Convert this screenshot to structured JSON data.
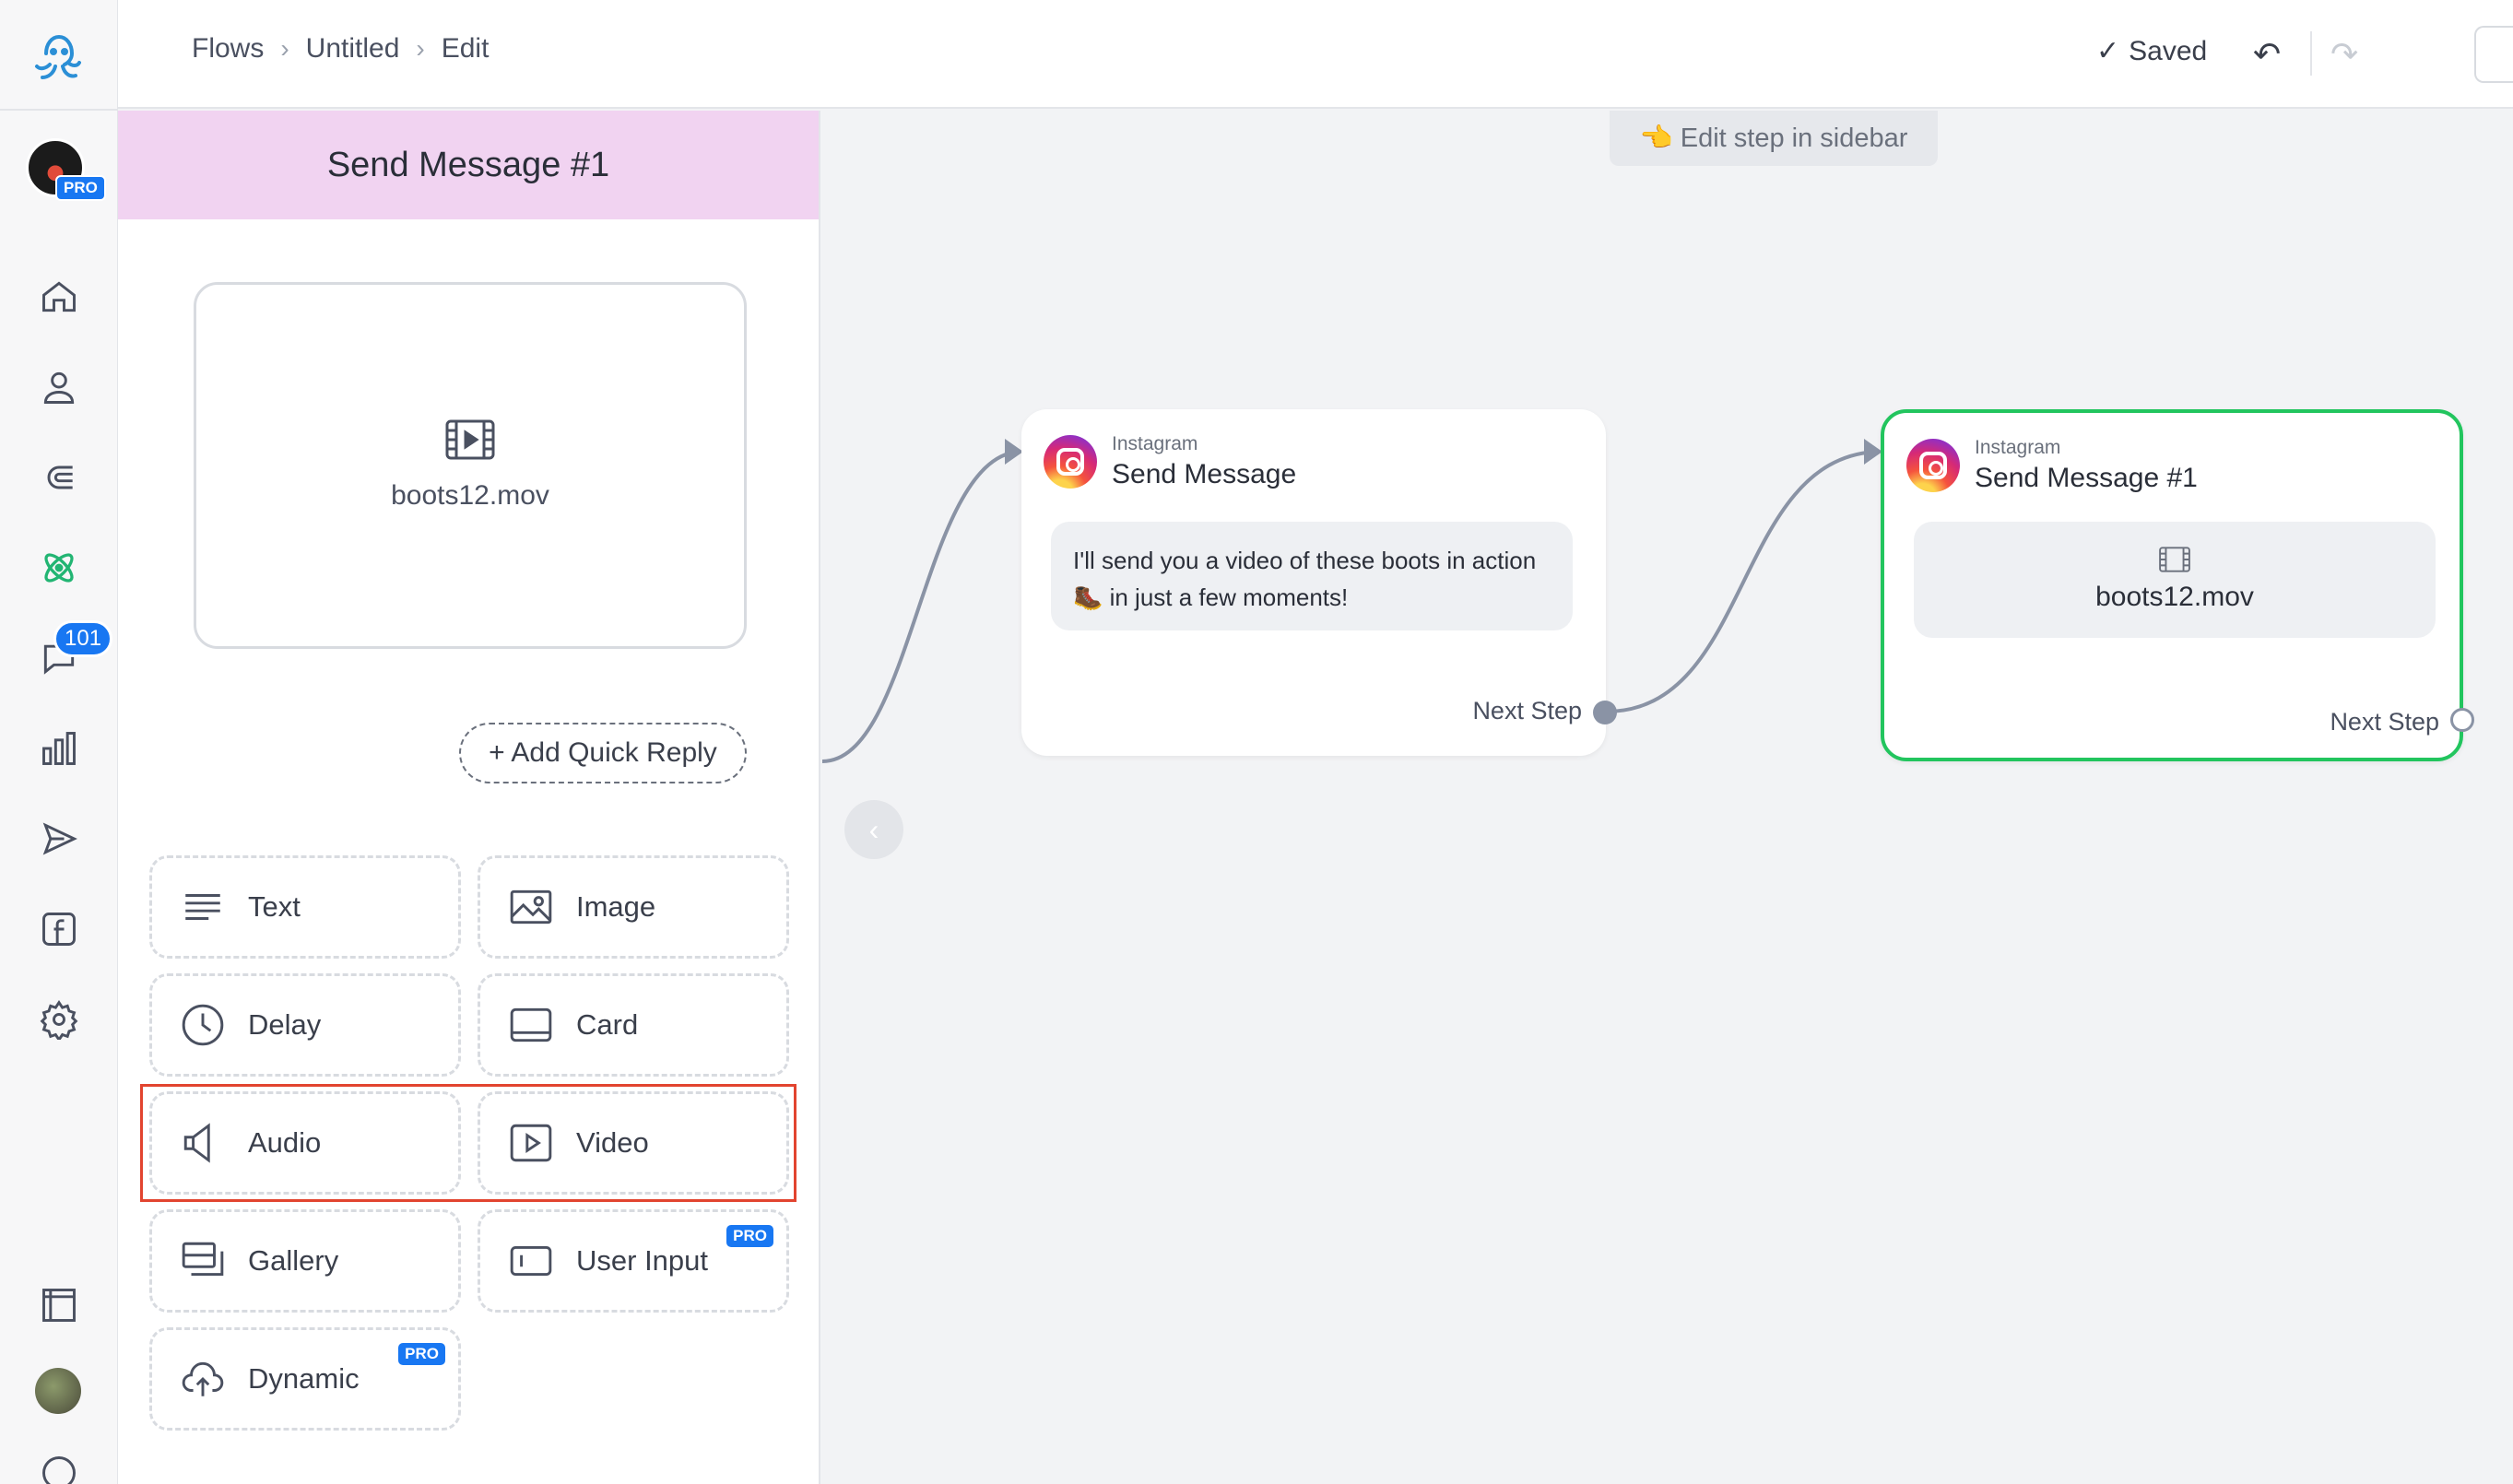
{
  "breadcrumbs": [
    "Flows",
    "Untitled",
    "Edit"
  ],
  "toolbar": {
    "saved_label": "Saved",
    "undo_glyph": "↶",
    "redo_glyph": "↷"
  },
  "rail": {
    "pro_badge": "PRO",
    "inbox_count": "101"
  },
  "panel": {
    "title": "Send Message #1",
    "media_file": "boots12.mov",
    "quick_reply_label": "+ Add Quick Reply",
    "blocks": [
      {
        "label": "Text",
        "icon": "text-lines-icon"
      },
      {
        "label": "Image",
        "icon": "image-icon"
      },
      {
        "label": "Delay",
        "icon": "clock-icon"
      },
      {
        "label": "Card",
        "icon": "card-icon"
      },
      {
        "label": "Audio",
        "icon": "speaker-icon"
      },
      {
        "label": "Video",
        "icon": "play-icon"
      },
      {
        "label": "Gallery",
        "icon": "gallery-icon"
      },
      {
        "label": "User Input",
        "icon": "input-icon",
        "pro": "PRO"
      },
      {
        "label": "Dynamic",
        "icon": "cloud-upload-icon",
        "pro": "PRO"
      }
    ]
  },
  "canvas": {
    "hint": "👈 Edit step in sidebar",
    "nodes": [
      {
        "platform": "Instagram",
        "title": "Send Message",
        "message": "I'll send you a video of these boots in action 🥾 in just a few moments!",
        "next": "Next Step"
      },
      {
        "platform": "Instagram",
        "title": "Send Message #1",
        "media_file": "boots12.mov",
        "next": "Next Step"
      }
    ]
  },
  "colors": {
    "accent": "#1877f2",
    "selected_node": "#22c55e",
    "highlight": "#e2442f",
    "panel_header": "#f1d3f1"
  }
}
